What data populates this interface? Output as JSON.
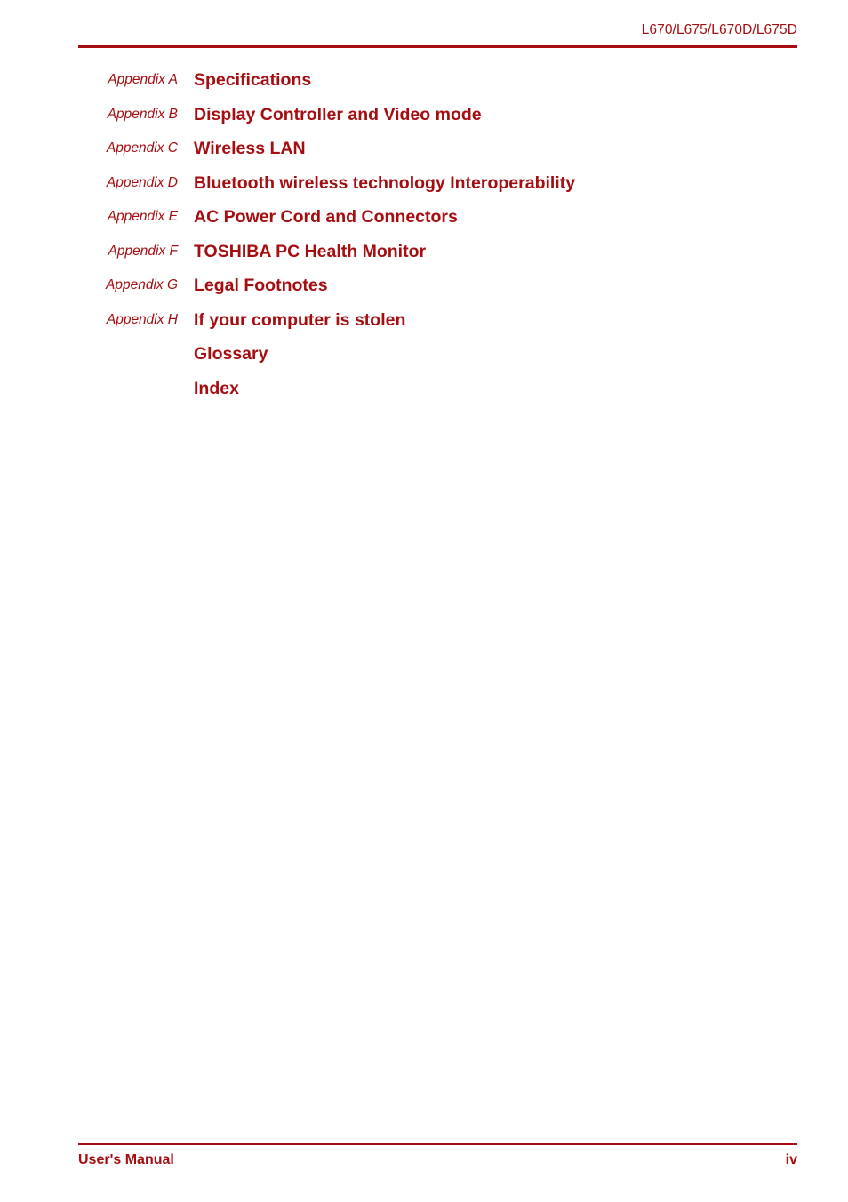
{
  "document": {
    "accent_color": "#a50d10",
    "background_color": "#ffffff"
  },
  "header": {
    "model_line": "L670/L675/L670D/L675D"
  },
  "toc": {
    "entries": [
      {
        "label": "Appendix A",
        "title": "Specifications"
      },
      {
        "label": "Appendix B",
        "title": "Display Controller and Video mode"
      },
      {
        "label": "Appendix C",
        "title": "Wireless LAN"
      },
      {
        "label": "Appendix D",
        "title": "Bluetooth wireless technology Interoperability"
      },
      {
        "label": "Appendix E",
        "title": "AC Power Cord and Connectors"
      },
      {
        "label": "Appendix F",
        "title": "TOSHIBA PC Health Monitor"
      },
      {
        "label": "Appendix G",
        "title": "Legal Footnotes"
      },
      {
        "label": "Appendix H",
        "title": "If your computer is stolen"
      },
      {
        "label": "",
        "title": "Glossary"
      },
      {
        "label": "",
        "title": "Index"
      }
    ]
  },
  "footer": {
    "manual_label": "User's Manual",
    "page_number": "iv"
  }
}
